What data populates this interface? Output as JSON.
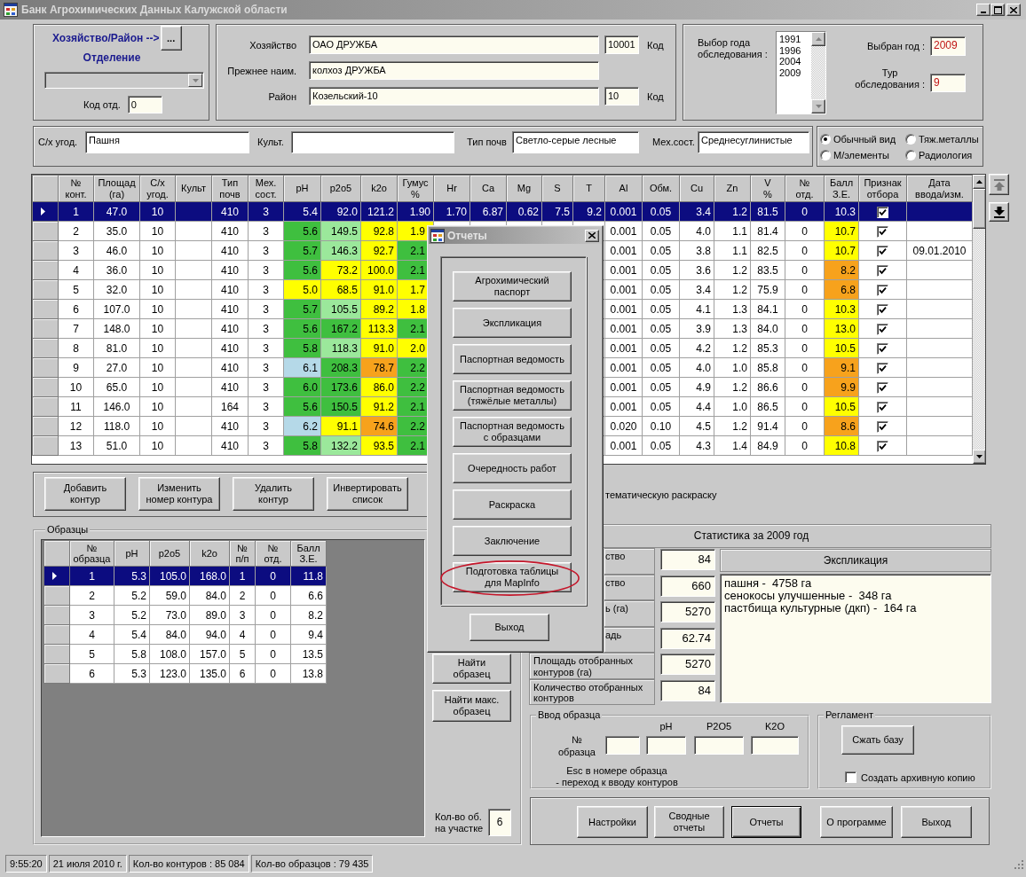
{
  "window": {
    "title": "Банк Агрохимических Данных Калужской области"
  },
  "farm_selector": {
    "link": "Хозяйство/Район -->",
    "browse_button": "...",
    "division_label": "Отделение",
    "division_combo": {
      "disabled": true
    },
    "division_code_label": "Код отд.",
    "division_code": "0"
  },
  "farm_info": [
    {
      "label": "Хозяйство",
      "value": "ОАО ДРУЖБА",
      "code": "10001",
      "code_label": "Код"
    },
    {
      "label": "Прежнее наим.",
      "value": "колхоз ДРУЖБА"
    },
    {
      "label": "Район",
      "value": "Козельский-10",
      "code": "10",
      "code_label": "Код"
    }
  ],
  "survey": {
    "years_label": "Выбор года\nобследования :",
    "years": [
      {
        "label": "1991",
        "selected": false
      },
      {
        "label": "1996",
        "selected": false
      },
      {
        "label": "2004",
        "selected": false
      },
      {
        "label": "2009",
        "selected": false
      }
    ],
    "selected_year_label": "Выбран год :",
    "selected_year": "2009",
    "round_label": "Тур\nобследования :",
    "round": "9"
  },
  "land": [
    {
      "label": "С/х угод.",
      "value": "Пашня"
    },
    {
      "label": "Культ."
    },
    {
      "label": "Тип почв",
      "value": "Светло-серые лесные"
    },
    {
      "label": "Мех.сост.",
      "value": "Среднесуглинистые"
    }
  ],
  "view_mode": [
    {
      "label": "Обычный вид",
      "selected": true
    },
    {
      "label": "Тяж.металлы",
      "selected": false
    },
    {
      "label": "М/элементы",
      "selected": false
    },
    {
      "label": "Радиология",
      "selected": false
    }
  ],
  "contours_table": {
    "columns": [
      "№\nконт.",
      "Площад\n(га)",
      "С/х\nугод.",
      "Культ",
      "Тип\nпочв",
      "Мех.\nсост.",
      "pH",
      "p2o5",
      "k2o",
      "Гумус\n%",
      "Hr",
      "Ca",
      "Mg",
      "S",
      "T",
      "Al",
      "Обм.",
      "Cu",
      "Zn",
      "V\n%",
      "№\nотд.",
      "Балл\nЗ.Е.",
      "Признак\nотбора",
      "Дата\nввода/изм."
    ],
    "rows": [
      {
        "selected": true,
        "cells": [
          "1",
          "47.0",
          "10",
          null,
          "410",
          "3",
          "5.4",
          "92.0",
          "121.2",
          "1.90",
          "1.70",
          "6.87",
          "0.62",
          "7.5",
          "9.2",
          "0.001",
          "0.05",
          "3.4",
          "1.2",
          "81.5",
          "0",
          "10.3",
          {
            "checked": true
          },
          null
        ]
      },
      {
        "selected": false,
        "cells": [
          "2",
          "35.0",
          "10",
          null,
          "410",
          "3",
          {
            "text": "5.6",
            "color": "#3fbf3f"
          },
          {
            "text": "149.5",
            "color": "#9be89b"
          },
          {
            "text": "92.8",
            "color": "#ffff00"
          },
          {
            "text": "1.9",
            "color": "#ffff00"
          },
          null,
          null,
          null,
          null,
          null,
          "0.001",
          "0.05",
          "4.0",
          "1.1",
          "81.4",
          "0",
          {
            "text": "10.7",
            "color": "#ffff00"
          },
          {
            "checked": true
          },
          null
        ]
      },
      {
        "selected": false,
        "cells": [
          "3",
          "46.0",
          "10",
          null,
          "410",
          "3",
          {
            "text": "5.7",
            "color": "#3fbf3f"
          },
          {
            "text": "146.3",
            "color": "#9be89b"
          },
          {
            "text": "92.7",
            "color": "#ffff00"
          },
          {
            "text": "2.1",
            "color": "#3fbf3f"
          },
          null,
          null,
          null,
          null,
          null,
          "0.001",
          "0.05",
          "3.8",
          "1.1",
          "82.5",
          "0",
          {
            "text": "10.7",
            "color": "#ffff00"
          },
          {
            "checked": true
          },
          "09.01.2010"
        ]
      },
      {
        "selected": false,
        "cells": [
          "4",
          "36.0",
          "10",
          null,
          "410",
          "3",
          {
            "text": "5.6",
            "color": "#3fbf3f"
          },
          {
            "text": "73.2",
            "color": "#ffff00"
          },
          {
            "text": "100.0",
            "color": "#ffff00"
          },
          {
            "text": "2.1",
            "color": "#3fbf3f"
          },
          null,
          null,
          null,
          null,
          null,
          "0.001",
          "0.05",
          "3.6",
          "1.2",
          "83.5",
          "0",
          {
            "text": "8.2",
            "color": "#f7a21c"
          },
          {
            "checked": true
          },
          null
        ]
      },
      {
        "selected": false,
        "cells": [
          "5",
          "32.0",
          "10",
          null,
          "410",
          "3",
          {
            "text": "5.0",
            "color": "#ffff00"
          },
          {
            "text": "68.5",
            "color": "#ffff00"
          },
          {
            "text": "91.0",
            "color": "#ffff00"
          },
          {
            "text": "1.7",
            "color": "#ffff00"
          },
          null,
          null,
          null,
          null,
          null,
          "0.001",
          "0.05",
          "3.4",
          "1.2",
          "75.9",
          "0",
          {
            "text": "6.8",
            "color": "#f7a21c"
          },
          {
            "checked": true
          },
          null
        ]
      },
      {
        "selected": false,
        "cells": [
          "6",
          "107.0",
          "10",
          null,
          "410",
          "3",
          {
            "text": "5.7",
            "color": "#3fbf3f"
          },
          {
            "text": "105.5",
            "color": "#9be89b"
          },
          {
            "text": "89.2",
            "color": "#ffff00"
          },
          {
            "text": "1.8",
            "color": "#ffff00"
          },
          null,
          null,
          null,
          null,
          null,
          "0.001",
          "0.05",
          "4.1",
          "1.3",
          "84.1",
          "0",
          {
            "text": "10.3",
            "color": "#ffff00"
          },
          {
            "checked": true
          },
          null
        ]
      },
      {
        "selected": false,
        "cells": [
          "7",
          "148.0",
          "10",
          null,
          "410",
          "3",
          {
            "text": "5.6",
            "color": "#3fbf3f"
          },
          {
            "text": "167.2",
            "color": "#3fbf3f"
          },
          {
            "text": "113.3",
            "color": "#ffff00"
          },
          {
            "text": "2.1",
            "color": "#3fbf3f"
          },
          null,
          null,
          null,
          null,
          null,
          "0.001",
          "0.05",
          "3.9",
          "1.3",
          "84.0",
          "0",
          {
            "text": "13.0",
            "color": "#ffff00"
          },
          {
            "checked": true
          },
          null
        ]
      },
      {
        "selected": false,
        "cells": [
          "8",
          "81.0",
          "10",
          null,
          "410",
          "3",
          {
            "text": "5.8",
            "color": "#3fbf3f"
          },
          {
            "text": "118.3",
            "color": "#9be89b"
          },
          {
            "text": "91.0",
            "color": "#ffff00"
          },
          {
            "text": "2.0",
            "color": "#ffff00"
          },
          null,
          null,
          null,
          null,
          null,
          "0.001",
          "0.05",
          "4.2",
          "1.2",
          "85.3",
          "0",
          {
            "text": "10.5",
            "color": "#ffff00"
          },
          {
            "checked": true
          },
          null
        ]
      },
      {
        "selected": false,
        "cells": [
          "9",
          "27.0",
          "10",
          null,
          "410",
          "3",
          {
            "text": "6.1",
            "color": "#b5d9e8"
          },
          {
            "text": "208.3",
            "color": "#3fbf3f"
          },
          {
            "text": "78.7",
            "color": "#f7a21c"
          },
          {
            "text": "2.2",
            "color": "#3fbf3f"
          },
          null,
          null,
          null,
          null,
          null,
          "0.001",
          "0.05",
          "4.0",
          "1.0",
          "85.8",
          "0",
          {
            "text": "9.1",
            "color": "#f7a21c"
          },
          {
            "checked": true
          },
          null
        ]
      },
      {
        "selected": false,
        "cells": [
          "10",
          "65.0",
          "10",
          null,
          "410",
          "3",
          {
            "text": "6.0",
            "color": "#3fbf3f"
          },
          {
            "text": "173.6",
            "color": "#3fbf3f"
          },
          {
            "text": "86.0",
            "color": "#ffff00"
          },
          {
            "text": "2.2",
            "color": "#3fbf3f"
          },
          null,
          null,
          null,
          null,
          null,
          "0.001",
          "0.05",
          "4.9",
          "1.2",
          "86.6",
          "0",
          {
            "text": "9.9",
            "color": "#f7a21c"
          },
          {
            "checked": true
          },
          null
        ]
      },
      {
        "selected": false,
        "cells": [
          "11",
          "146.0",
          "10",
          null,
          "164",
          "3",
          {
            "text": "5.6",
            "color": "#3fbf3f"
          },
          {
            "text": "150.5",
            "color": "#3fbf3f"
          },
          {
            "text": "91.2",
            "color": "#ffff00"
          },
          {
            "text": "2.1",
            "color": "#3fbf3f"
          },
          null,
          null,
          null,
          null,
          null,
          "0.001",
          "0.05",
          "4.4",
          "1.0",
          "86.5",
          "0",
          {
            "text": "10.5",
            "color": "#ffff00"
          },
          {
            "checked": true
          },
          null
        ]
      },
      {
        "selected": false,
        "cells": [
          "12",
          "118.0",
          "10",
          null,
          "410",
          "3",
          {
            "text": "6.2",
            "color": "#b5d9e8"
          },
          {
            "text": "91.1",
            "color": "#ffff00"
          },
          {
            "text": "74.6",
            "color": "#f7a21c"
          },
          {
            "text": "2.2",
            "color": "#3fbf3f"
          },
          null,
          null,
          null,
          null,
          null,
          "0.020",
          "0.10",
          "4.5",
          "1.2",
          "91.4",
          "0",
          {
            "text": "8.6",
            "color": "#f7a21c"
          },
          {
            "checked": true
          },
          null
        ]
      },
      {
        "selected": false,
        "cells": [
          "13",
          "51.0",
          "10",
          null,
          "410",
          "3",
          {
            "text": "5.8",
            "color": "#3fbf3f"
          },
          {
            "text": "132.2",
            "color": "#9be89b"
          },
          {
            "text": "93.5",
            "color": "#ffff00"
          },
          {
            "text": "2.1",
            "color": "#3fbf3f"
          },
          null,
          null,
          null,
          null,
          null,
          "0.001",
          "0.05",
          "4.3",
          "1.4",
          "84.9",
          "0",
          {
            "text": "10.8",
            "color": "#ffff00"
          },
          {
            "checked": true
          },
          null
        ]
      }
    ],
    "nav_buttons": [
      {
        "disabled": true
      },
      {
        "disabled": false
      }
    ]
  },
  "contour_buttons": [
    "Добавить\nконтур",
    "Изменить\nномер контура",
    "Удалить\nконтур",
    "Инвертировать\nсписок"
  ],
  "theme_option": "тематическую раскраску",
  "samples": {
    "title": "Образцы",
    "columns": [
      "№\nобразца",
      "pH",
      "p2o5",
      "k2o",
      "№\nп/п",
      "№\nотд.",
      "Балл\nЗ.Е."
    ],
    "rows": [
      {
        "selected": true,
        "cells": [
          "1",
          "5.3",
          "105.0",
          "168.0",
          "1",
          "0",
          "11.8"
        ]
      },
      {
        "selected": false,
        "cells": [
          "2",
          "5.2",
          "59.0",
          "84.0",
          "2",
          "0",
          "6.6"
        ]
      },
      {
        "selected": false,
        "cells": [
          "3",
          "5.2",
          "73.0",
          "89.0",
          "3",
          "0",
          "8.2"
        ]
      },
      {
        "selected": false,
        "cells": [
          "4",
          "5.4",
          "84.0",
          "94.0",
          "4",
          "0",
          "9.4"
        ]
      },
      {
        "selected": false,
        "cells": [
          "5",
          "5.8",
          "108.0",
          "157.0",
          "5",
          "0",
          "13.5"
        ]
      },
      {
        "selected": false,
        "cells": [
          "6",
          "5.3",
          "123.0",
          "135.0",
          "6",
          "0",
          "13.8"
        ]
      }
    ],
    "find_button": "Найти\nобразец",
    "find_max_button": "Найти макс.\nобразец",
    "count_label": "Кол-во об.\nна участке",
    "count": "6"
  },
  "statistics": {
    "title": "Статистика за 2009 год",
    "rows": [
      {
        "label": "ство",
        "value": "84",
        "kind": "partial"
      },
      {
        "label": "ство",
        "value": "660",
        "kind": "partial"
      },
      {
        "label": "ь (га)",
        "value": "5270",
        "kind": "partial"
      },
      {
        "label": "адь",
        "value": "62.74",
        "kind": "partial"
      },
      {
        "label": "Площадь отобранных контуров (га)",
        "value": "5270",
        "kind": "full"
      },
      {
        "label": "Количество отобранных контуров",
        "value": "84",
        "kind": "full"
      }
    ],
    "explication_title": "Экспликация",
    "explication": [
      "пашня -  4758 га",
      "сенокосы улучшенные -  348 га",
      "пастбища культурные (дкп) -  164 га"
    ]
  },
  "sample_entry": {
    "title": "Ввод образца",
    "number_label": "№\nобразца",
    "columns": [
      "pH",
      "P2O5",
      "K2O"
    ],
    "note": "Esc в номере образца\n- переход к вводу контуров"
  },
  "maintenance": {
    "title": "Регламент",
    "compress_button": "Сжать базу",
    "archive_checkbox": {
      "label": "Создать архивную копию",
      "checked": false
    }
  },
  "bottom_buttons": [
    {
      "label": "Настройки",
      "default": false
    },
    {
      "label": "Сводные\nотчеты",
      "default": false
    },
    {
      "label": "Отчеты",
      "default": true
    },
    {
      "label": "О программе",
      "default": false
    },
    {
      "label": "Выход",
      "default": false
    }
  ],
  "status_bar": [
    "9:55:20",
    "21 июля 2010 г.",
    "Кол-во контуров : 85 084",
    "Кол-во образцов : 79 435"
  ],
  "reports_dialog": {
    "title": "Отчеты",
    "buttons": [
      {
        "label": "Агрохимический\nпаспорт",
        "highlighted": false
      },
      {
        "label": "Экспликация",
        "highlighted": false
      },
      {
        "label": "Паспортная ведомость",
        "highlighted": false
      },
      {
        "label": "Паспортная ведомость\n(тяжёлые металлы)",
        "highlighted": false
      },
      {
        "label": "Паспортная ведомость\nс образцами",
        "highlighted": false
      },
      {
        "label": "Очередность работ",
        "highlighted": false
      },
      {
        "label": "Раскраска",
        "highlighted": false
      },
      {
        "label": "Заключение",
        "highlighted": false
      },
      {
        "label": "Подготовка таблицы\nдля MapInfo",
        "highlighted": true
      }
    ],
    "exit_button": "Выход"
  }
}
